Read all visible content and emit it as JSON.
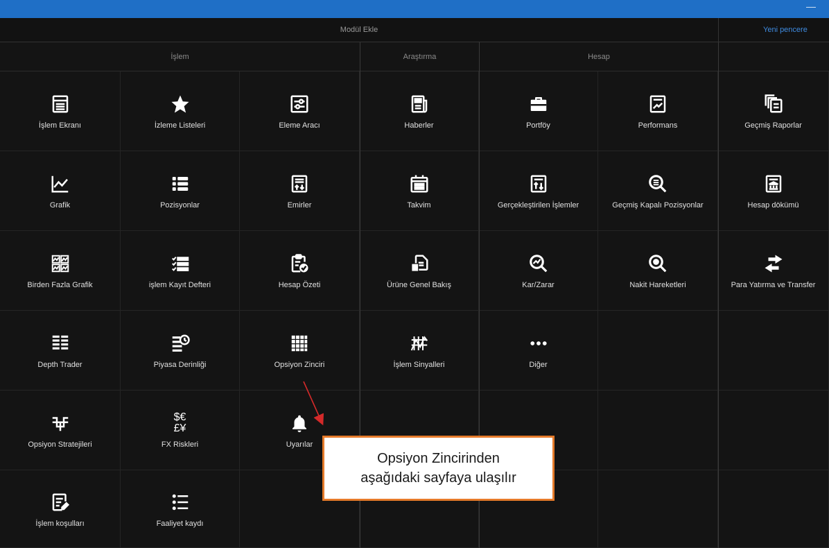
{
  "window": {
    "minimize_glyph": "—"
  },
  "header": {
    "title": "Modül Ekle",
    "new_window": "Yeni pencere"
  },
  "sections": [
    {
      "label": "İşlem"
    },
    {
      "label": "Araştırma"
    },
    {
      "label": "Hesap"
    }
  ],
  "tiles": {
    "islem_ekrani": {
      "label": "İşlem Ekranı",
      "icon": "calculator-icon"
    },
    "izleme_listeleri": {
      "label": "İzleme Listeleri",
      "icon": "star-icon"
    },
    "eleme_araci": {
      "label": "Eleme Aracı",
      "icon": "sliders-icon"
    },
    "haberler": {
      "label": "Haberler",
      "icon": "newspaper-icon"
    },
    "portfoy": {
      "label": "Portföy",
      "icon": "briefcase-icon"
    },
    "performans": {
      "label": "Performans",
      "icon": "chart-report-icon"
    },
    "gecmis_raporlar": {
      "label": "Geçmiş Raporlar",
      "icon": "documents-stack-icon"
    },
    "grafik": {
      "label": "Grafik",
      "icon": "line-chart-icon"
    },
    "pozisyonlar": {
      "label": "Pozisyonlar",
      "icon": "list-icon"
    },
    "emirler": {
      "label": "Emirler",
      "icon": "order-form-icon"
    },
    "takvim": {
      "label": "Takvim",
      "icon": "calendar-icon"
    },
    "gerceklestirilen": {
      "label": "Gerçekleştirilen İşlemler",
      "icon": "trade-arrows-doc-icon"
    },
    "gecmis_kapali": {
      "label": "Geçmiş Kapalı Pozisyonlar",
      "icon": "search-list-icon"
    },
    "hesap_dokumu": {
      "label": "Hesap dökümü",
      "icon": "bank-statement-icon"
    },
    "birden_fazla": {
      "label": "Birden Fazla Grafik",
      "icon": "multi-chart-icon"
    },
    "islem_kayit": {
      "label": "işlem Kayıt Defteri",
      "icon": "checklist-icon"
    },
    "hesap_ozeti": {
      "label": "Hesap Özeti",
      "icon": "clipboard-check-icon"
    },
    "urune_genel": {
      "label": "Ürüne Genel Bakış",
      "icon": "file-overview-icon"
    },
    "kar_zarar": {
      "label": "Kar/Zarar",
      "icon": "magnifier-chart-icon"
    },
    "nakit": {
      "label": "Nakit Hareketleri",
      "icon": "magnifier-coin-icon"
    },
    "para_yatirma": {
      "label": "Para Yatırma ve Transfer",
      "icon": "transfer-arrows-icon"
    },
    "depth_trader": {
      "label": "Depth Trader",
      "icon": "depth-bars-icon"
    },
    "piyasa_derinligi": {
      "label": "Piyasa Derinliği",
      "icon": "clock-list-icon"
    },
    "opsiyon_zinciri": {
      "label": "Opsiyon Zinciri",
      "icon": "grid-icon"
    },
    "islem_sinyalleri": {
      "label": "İşlem Sinyalleri",
      "icon": "signal-chart-icon"
    },
    "diger": {
      "label": "Diğer",
      "icon": "ellipsis-icon"
    },
    "opsiyon_strat": {
      "label": "Opsiyon Stratejileri",
      "icon": "strategy-icon"
    },
    "fx_riskleri": {
      "label": "FX Riskleri",
      "icon": "currency-icon"
    },
    "uyarilar": {
      "label": "Uyarılar",
      "icon": "bell-icon"
    },
    "islem_kosullari": {
      "label": "İşlem koşulları",
      "icon": "document-pen-icon"
    },
    "faaliyet_kaydi": {
      "label": "Faaliyet kaydı",
      "icon": "bullet-list-icon"
    }
  },
  "fx_symbols": {
    "top": "$€",
    "bottom": "£¥"
  },
  "callout": {
    "line1": "Opsiyon Zincirinden",
    "line2": "aşağıdaki sayfaya ulaşılır"
  },
  "colors": {
    "topbar": "#1f6fc6",
    "background": "#141414",
    "link": "#3f8be0",
    "callout_border": "#e57a2a",
    "annotation_arrow": "#d42a2a"
  }
}
